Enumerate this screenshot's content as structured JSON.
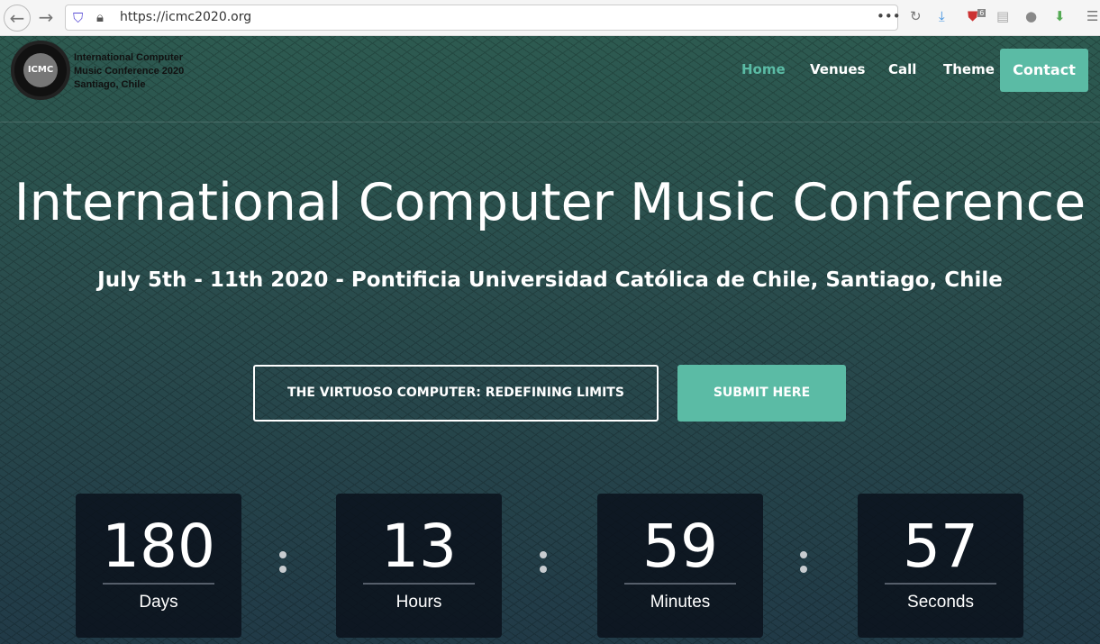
{
  "browser": {
    "url": "https://icmc2020.org",
    "badge_count": "6"
  },
  "logo": {
    "mark": "ICMC",
    "lines": [
      "International Computer",
      "Music Conference 2020",
      "Santiago, Chile"
    ]
  },
  "nav": {
    "items": [
      "Home",
      "Venues",
      "Call",
      "Theme"
    ],
    "contact": "Contact",
    "active": "Home",
    "accent": "#5bbba5"
  },
  "hero": {
    "title": "International Computer Music Conference",
    "subtitle": "July 5th - 11th 2020 - Pontificia Universidad Católica de Chile, Santiago, Chile",
    "theme_button": "THE VIRTUOSO COMPUTER: REDEFINING LIMITS",
    "submit_button": "SUBMIT HERE",
    "watermark": "ICMC"
  },
  "countdown": [
    {
      "value": "180",
      "label": "Days"
    },
    {
      "value": "13",
      "label": "Hours"
    },
    {
      "value": "59",
      "label": "Minutes"
    },
    {
      "value": "57",
      "label": "Seconds"
    }
  ]
}
